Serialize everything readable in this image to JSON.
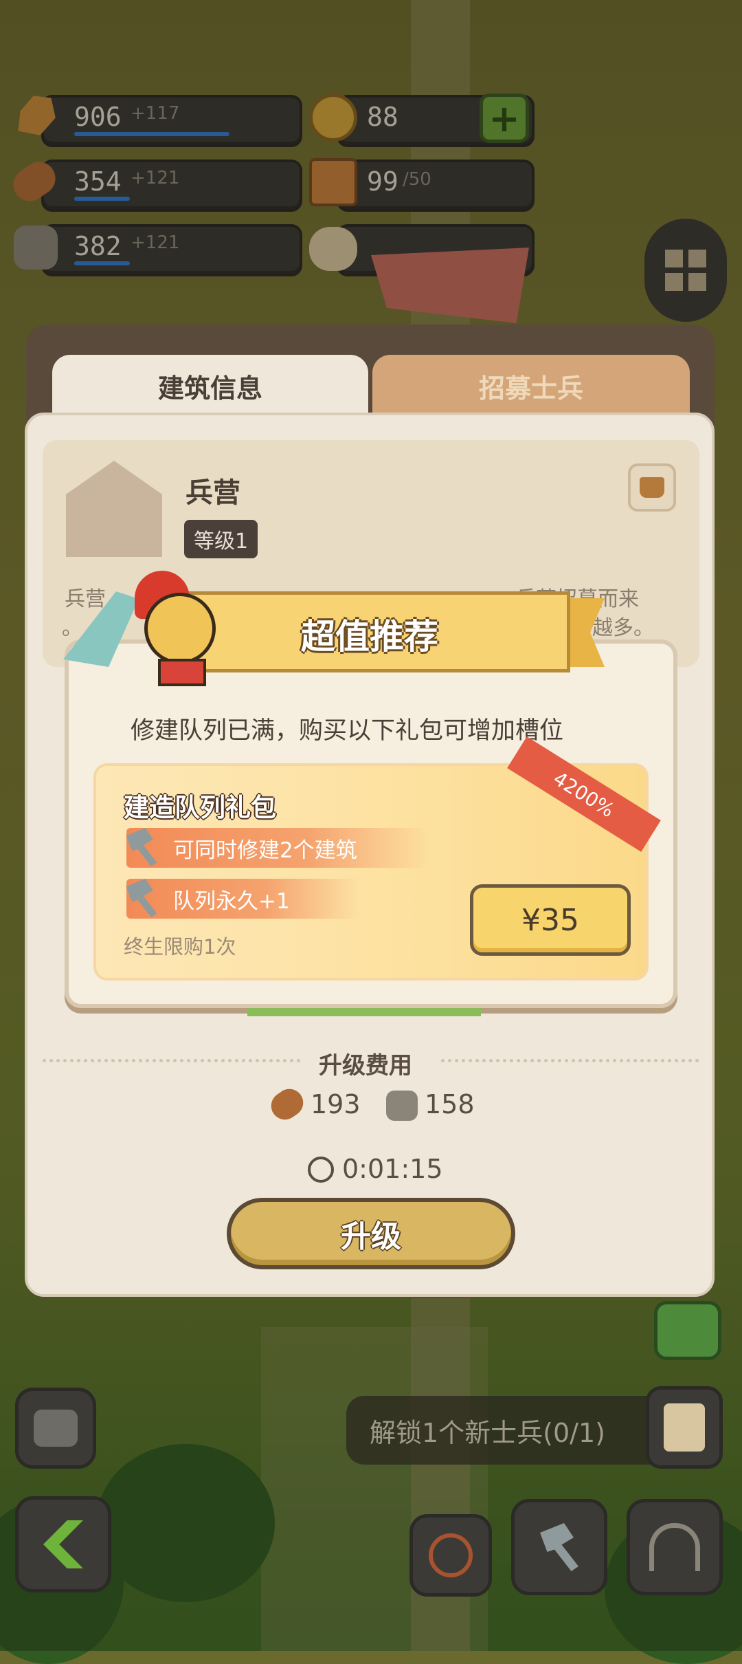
{
  "resources": [
    {
      "icon": "wheat-icon",
      "value": "906",
      "extra": "+117",
      "fill": 0.78
    },
    {
      "icon": "wood-log-icon",
      "value": "354",
      "extra": "+121",
      "fill": 0.28
    },
    {
      "icon": "stone-icon",
      "value": "382",
      "extra": "+121",
      "fill": 0.28
    }
  ],
  "coins": {
    "icon": "coin-icon",
    "value": "88"
  },
  "gifts": {
    "icon": "gift-icon",
    "value": "99",
    "max": "/50"
  },
  "tabs": {
    "info": "建筑信息",
    "recruit": "招募士兵"
  },
  "building": {
    "name": "兵营",
    "level": "等级1",
    "desc_line1": "兵营",
    "desc_line1_right": "兵营招募而来",
    "desc_line2": "。",
    "desc_line2_right": "越多。"
  },
  "popup": {
    "title": "超值推荐",
    "message": "修建队列已满，购买以下礼包可增加槽位",
    "pack_name": "建造队列礼包",
    "ribbon": "4200%",
    "features": [
      "可同时修建2个建筑",
      "队列永久+1"
    ],
    "limit": "终生限购1次",
    "price": "¥35"
  },
  "upgrade": {
    "cost_label": "升级费用",
    "wood": "193",
    "stone": "158",
    "time": "0:01:15",
    "button": "升级"
  },
  "quest": {
    "text": "解锁1个新士兵(0/1)"
  },
  "colors": {
    "accent": "#f8d46c",
    "ribbon": "#e45c44",
    "feature": "#f28a56",
    "bar": "#2e7bd3"
  }
}
